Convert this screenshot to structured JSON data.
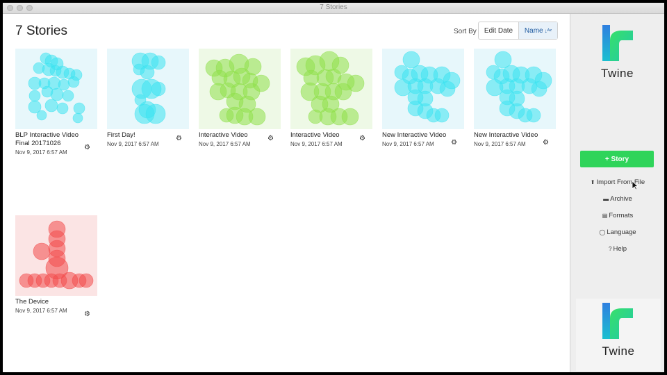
{
  "window": {
    "title": "7 Stories"
  },
  "header": {
    "title": "7 Stories",
    "sort_label": "Sort By",
    "sort_options": [
      "Edit Date",
      "Name"
    ],
    "sort_selected": "Name",
    "sort_icon": "sort-alpha-icon"
  },
  "stories": [
    {
      "name": "BLP Interactive Video Final 20171026",
      "date": "Nov 9, 2017 6:57 AM",
      "thumb_color": "#3de3f0",
      "thumb_bg": "#e7f7fb"
    },
    {
      "name": "First Day!",
      "date": "Nov 9, 2017 6:57 AM",
      "thumb_color": "#3de3f0",
      "thumb_bg": "#e7f7fb"
    },
    {
      "name": "Interactive Video",
      "date": "Nov 9, 2017 6:57 AM",
      "thumb_color": "#8fe04a",
      "thumb_bg": "#eef9e6"
    },
    {
      "name": "Interactive Video",
      "date": "Nov 9, 2017 6:57 AM",
      "thumb_color": "#8fe04a",
      "thumb_bg": "#eef9e6"
    },
    {
      "name": "New Interactive Video",
      "date": "Nov 9, 2017 6:57 AM",
      "thumb_color": "#3de3f0",
      "thumb_bg": "#e7f7fb"
    },
    {
      "name": "New Interactive Video",
      "date": "Nov 9, 2017 6:57 AM",
      "thumb_color": "#3de3f0",
      "thumb_bg": "#e7f7fb"
    },
    {
      "name": "The Device",
      "date": "Nov 9, 2017 6:57 AM",
      "thumb_color": "#f24a4a",
      "thumb_bg": "#fbe4e4"
    }
  ],
  "sidebar": {
    "logo_text": "Twine",
    "story_button": "+ Story",
    "links": [
      {
        "label": "Import From File",
        "icon": "upload-icon"
      },
      {
        "label": "Archive",
        "icon": "briefcase-icon"
      },
      {
        "label": "Formats",
        "icon": "file-icon"
      },
      {
        "label": "Language",
        "icon": "speech-bubble-icon"
      },
      {
        "label": "Help",
        "icon": "question-circle-icon"
      }
    ],
    "bottom_logo_text": "Twine"
  },
  "colors": {
    "accent_green": "#2fd45a",
    "logo_blue": "#2f7fe0",
    "logo_green": "#38e06a",
    "sort_selected_bg": "#e8f1f9"
  }
}
